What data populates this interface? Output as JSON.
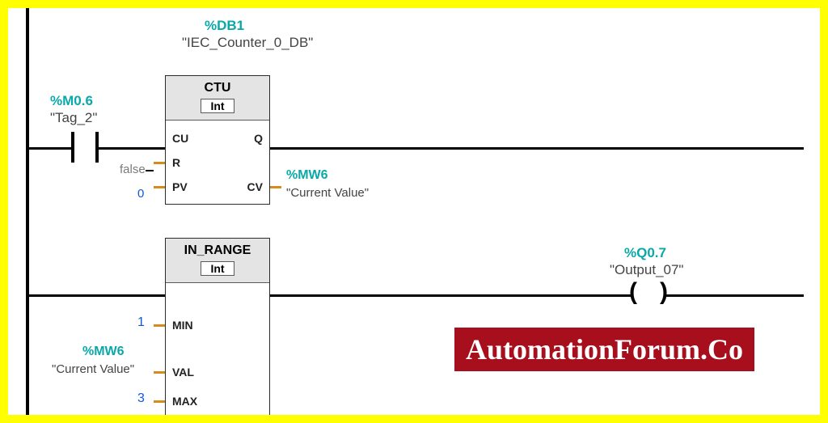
{
  "rung1": {
    "contact": {
      "address": "%M0.6",
      "name": "\"Tag_2\""
    },
    "block": {
      "db_address": "%DB1",
      "db_name": "\"IEC_Counter_0_DB\"",
      "title": "CTU",
      "type": "Int",
      "pins": {
        "CU": "CU",
        "R": "R",
        "PV": "PV",
        "Q": "Q",
        "CV": "CV"
      },
      "R_value": "false",
      "PV_value": "0",
      "CV_addr": "%MW6",
      "CV_name": "\"Current Value\""
    }
  },
  "rung2": {
    "block": {
      "title": "IN_RANGE",
      "type": "Int",
      "pins": {
        "MIN": "MIN",
        "VAL": "VAL",
        "MAX": "MAX"
      },
      "MIN_value": "1",
      "VAL_addr": "%MW6",
      "VAL_name": "\"Current Value\"",
      "MAX_value": "3"
    },
    "coil": {
      "address": "%Q0.7",
      "name": "\"Output_07\""
    }
  },
  "banner": "AutomationForum.Co"
}
